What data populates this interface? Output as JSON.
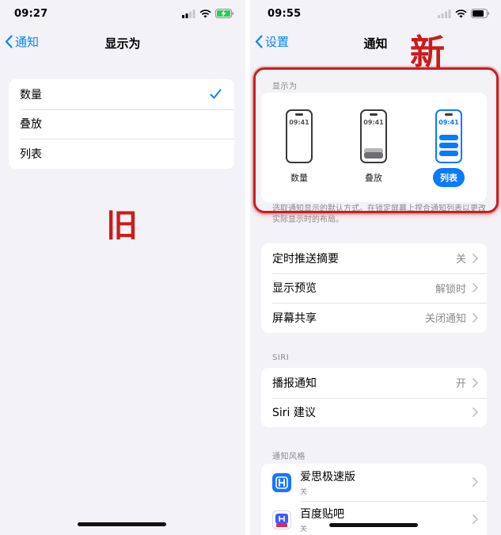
{
  "left": {
    "status_time": "09:27",
    "nav_back": "通知",
    "nav_title": "显示为",
    "options": [
      "数量",
      "叠放",
      "列表"
    ],
    "selected_index": 0,
    "annotation": "旧"
  },
  "right": {
    "status_time": "09:55",
    "nav_back": "设置",
    "nav_title": "通知",
    "annotation": "新",
    "display_section": {
      "label": "显示为",
      "options": [
        {
          "label": "数量",
          "time": "09:41"
        },
        {
          "label": "叠放",
          "time": "09:41"
        },
        {
          "label": "列表",
          "time": "09:41"
        }
      ],
      "selected_label": "列表",
      "footer": "选取通知显示的默认方式。在锁定屏幕上捏合通知列表以更改实际显示时的布局。"
    },
    "settings": [
      {
        "label": "定时推送摘要",
        "value": "关"
      },
      {
        "label": "显示预览",
        "value": "解锁时"
      },
      {
        "label": "屏幕共享",
        "value": "关闭通知"
      }
    ],
    "siri_section": {
      "label": "SIRI",
      "rows": [
        {
          "label": "播报通知",
          "value": "开"
        },
        {
          "label": "Siri 建议",
          "value": ""
        }
      ]
    },
    "style_section": {
      "label": "通知风格",
      "apps": [
        {
          "name": "爱思极速版",
          "sub": "关",
          "icon": "aisi-app-icon"
        },
        {
          "name": "百度贴吧",
          "sub": "关",
          "icon": "baidu-tieba-app-icon"
        }
      ]
    }
  },
  "colors": {
    "accent": "#0a84ff",
    "annotation_red": "#cc1b1b",
    "background": "#f2f2f7"
  }
}
